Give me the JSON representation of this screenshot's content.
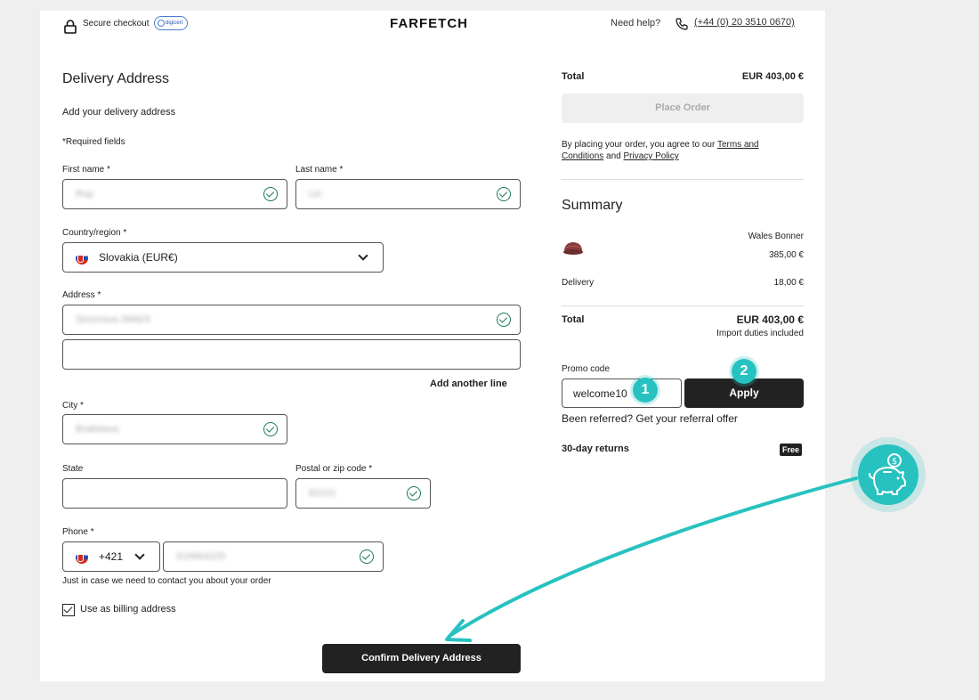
{
  "header": {
    "secure_checkout": "Secure checkout",
    "digicert": "digicert",
    "brand": "FARFETCH",
    "need_help": "Need help?",
    "phone": "(+44 (0) 20 3510 0670)"
  },
  "form": {
    "title": "Delivery Address",
    "subtitle": "Add your delivery address",
    "required": "*Required fields",
    "first_name_label": "First name *",
    "first_name_value": "Rup",
    "last_name_label": "Last name *",
    "last_name_value": "Lin",
    "country_label": "Country/region *",
    "country_value": "Slovakia (EUR€)",
    "address_label": "Address *",
    "address_value": "Stromova 2666/3",
    "add_line": "Add another line",
    "city_label": "City *",
    "city_value": "Bratislava",
    "state_label": "State",
    "postal_label": "Postal or zip code *",
    "postal_value": "82101",
    "phone_label": "Phone *",
    "phone_code": "+421",
    "phone_value": "919964225",
    "phone_hint": "Just in case we need to contact you about your order",
    "billing_label": "Use as billing address",
    "confirm_button": "Confirm Delivery Address"
  },
  "order": {
    "total_label": "Total",
    "total_value": "EUR 403,00 €",
    "place_order": "Place Order",
    "terms_prefix": "By placing your order, you agree to our",
    "terms_link": "Terms and Conditions",
    "and": "and",
    "privacy_link": "Privacy Policy"
  },
  "summary": {
    "title": "Summary",
    "item_brand": "Wales Bonner",
    "item_price": "385,00 €",
    "delivery_label": "Delivery",
    "delivery_value": "18,00 €",
    "total_label": "Total",
    "total_value": "EUR 403,00 €",
    "duties": "Import duties included",
    "promo_label": "Promo code",
    "promo_value": "welcome10",
    "apply": "Apply",
    "referral": "Been referred? Get your referral offer",
    "returns": "30-day returns",
    "free": "Free"
  },
  "annotations": {
    "step1": "1",
    "step2": "2",
    "accent": "#27c2c0",
    "icon": "piggy-bank-icon"
  }
}
